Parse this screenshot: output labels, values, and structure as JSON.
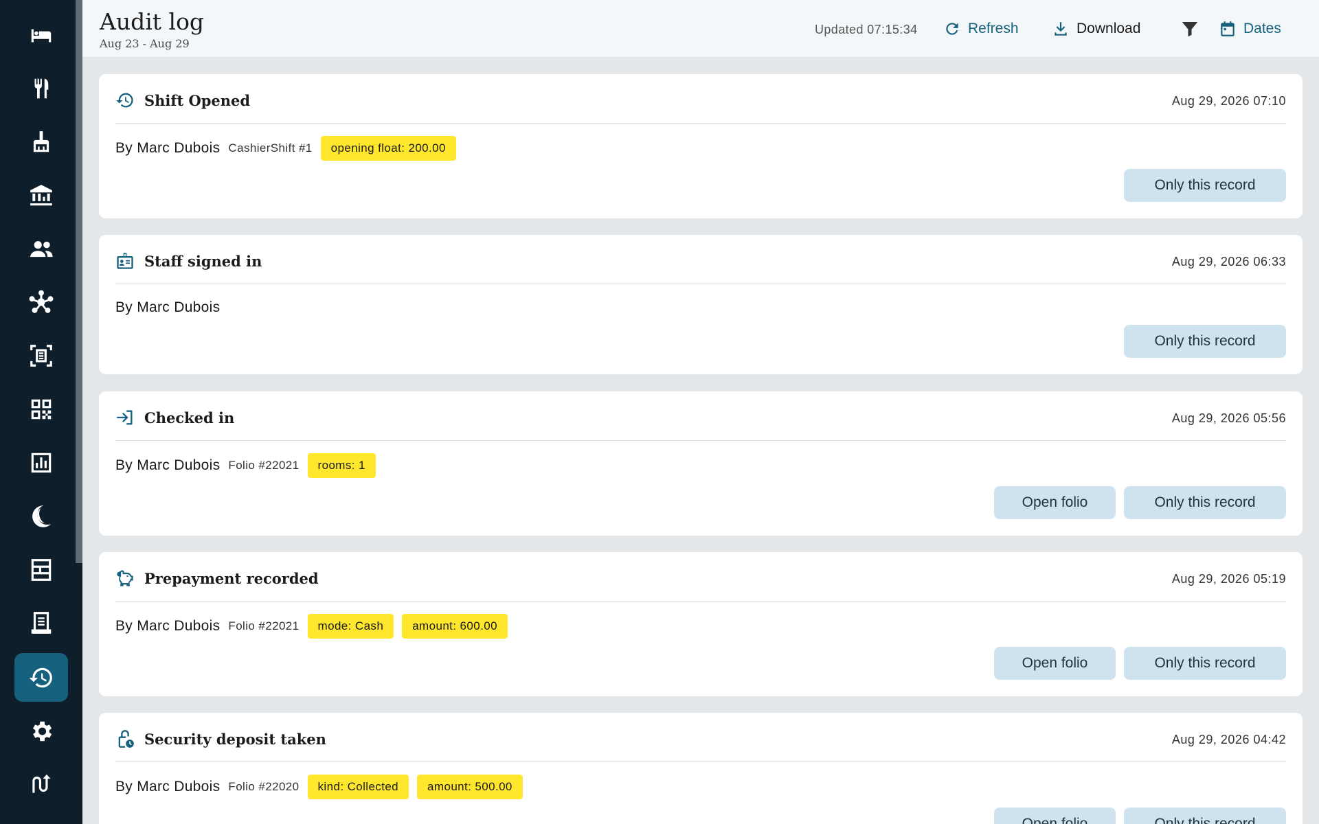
{
  "header": {
    "title": "Audit log",
    "date_range": "Aug 23 - Aug 29",
    "updated": "Updated 07:15:34",
    "refresh_label": "Refresh",
    "download_label": "Download",
    "dates_label": "Dates"
  },
  "sidebar": {
    "items": [
      {
        "icon": "bed-icon"
      },
      {
        "icon": "restaurant-icon"
      },
      {
        "icon": "cleaning-icon"
      },
      {
        "icon": "bank-icon"
      },
      {
        "icon": "people-icon"
      },
      {
        "icon": "hub-icon"
      },
      {
        "icon": "receipt-scan-icon"
      },
      {
        "icon": "qr-code-icon"
      },
      {
        "icon": "report-icon"
      },
      {
        "icon": "night-audit-icon"
      },
      {
        "icon": "room-grid-icon"
      },
      {
        "icon": "invoice-icon"
      },
      {
        "icon": "history-icon",
        "active": true
      },
      {
        "icon": "settings-icon"
      },
      {
        "icon": "exchange-icon"
      }
    ]
  },
  "entries": [
    {
      "icon": "history-icon",
      "title": "Shift Opened",
      "time": "Aug 29, 2026 07:10",
      "by": "By Marc Dubois",
      "ref": "CashierShift #1",
      "tags": [
        "opening float: 200.00"
      ],
      "open_folio": "",
      "only_record": "Only this record"
    },
    {
      "icon": "staff-badge-icon",
      "title": "Staff signed in",
      "time": "Aug 29, 2026 06:33",
      "by": "By Marc Dubois",
      "ref": "",
      "tags": [],
      "open_folio": "",
      "only_record": "Only this record"
    },
    {
      "icon": "login-icon",
      "title": "Checked in",
      "time": "Aug 29, 2026 05:56",
      "by": "By Marc Dubois",
      "ref": "Folio #22021",
      "tags": [
        "rooms: 1"
      ],
      "open_folio": "Open folio",
      "only_record": "Only this record"
    },
    {
      "icon": "piggy-bank-icon",
      "title": "Prepayment recorded",
      "time": "Aug 29, 2026 05:19",
      "by": "By Marc Dubois",
      "ref": "Folio #22021",
      "tags": [
        "mode: Cash",
        "amount: 600.00"
      ],
      "open_folio": "Open folio",
      "only_record": "Only this record"
    },
    {
      "icon": "lock-clock-icon",
      "title": "Security deposit taken",
      "time": "Aug 29, 2026 04:42",
      "by": "By Marc Dubois",
      "ref": "Folio #22020",
      "tags": [
        "kind: Collected",
        "amount: 500.00"
      ],
      "open_folio": "Open folio",
      "only_record": "Only this record"
    }
  ],
  "colors": {
    "sidebar_bg": "#0e1f2b",
    "accent": "#16627e",
    "tag_bg": "#ffe72e",
    "button_bg": "#cfe3ee"
  }
}
